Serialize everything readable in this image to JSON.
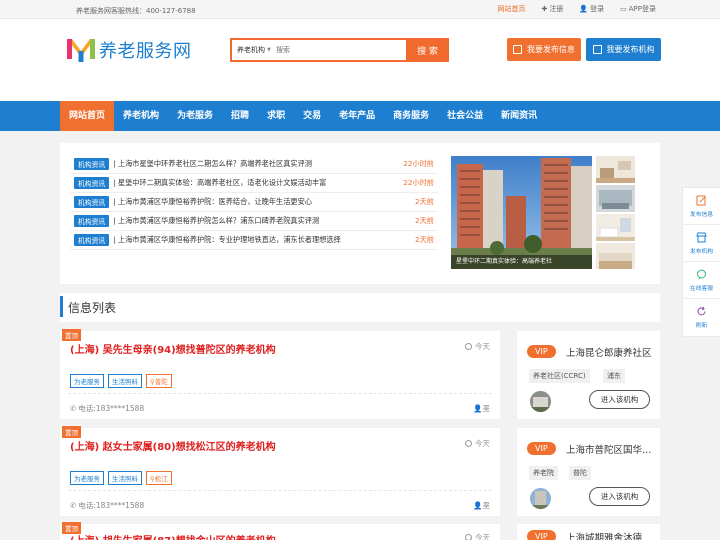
{
  "topbar": {
    "hotline": "养老服务网客服热线：400-127-6788",
    "links": [
      {
        "label": "网站首页",
        "active": true,
        "icon": ""
      },
      {
        "label": "注册",
        "active": false,
        "icon": "plus-icon"
      },
      {
        "label": "登录",
        "active": false,
        "icon": "user-icon"
      },
      {
        "label": "APP登录",
        "active": false,
        "icon": "laptop-icon"
      }
    ]
  },
  "header": {
    "logo_text": "养老服务网",
    "search": {
      "category": "养老机构",
      "placeholder": "搜索",
      "button": "搜 索"
    },
    "publish_info": "我要发布信息",
    "publish_org": "我要发布机构"
  },
  "nav": {
    "items": [
      "网站首页",
      "养老机构",
      "为老服务",
      "招聘",
      "求职",
      "交易",
      "老年产品",
      "商务服务",
      "社会公益",
      "新闻资讯"
    ]
  },
  "news": {
    "items": [
      {
        "tag": "机构资讯",
        "title": "| 上海市星堡中环养老社区二期怎么样？高端养老社区真实评测",
        "time": "22小时前"
      },
      {
        "tag": "机构资讯",
        "title": "| 星堡中环二期真实体验：高端养老社区，适老化设计文娱活动丰富",
        "time": "22小时前"
      },
      {
        "tag": "机构资讯",
        "title": "| 上海市黄浦区华康恒裕养护院：医养结合，让晚年生活更安心",
        "time": "2天前"
      },
      {
        "tag": "机构资讯",
        "title": "| 上海市黄浦区华康恒裕养护院怎么样？浦东口碑养老院真实评测",
        "time": "2天前"
      },
      {
        "tag": "机构资讯",
        "title": "| 上海市黄浦区华康恒裕养护院：专业护理地铁直达，浦东长者理想选择",
        "time": "2天前"
      }
    ],
    "photo_caption": "星堡中环二期真实体验：高端养老社"
  },
  "section": {
    "title": "信息列表"
  },
  "listings": [
    {
      "flag": "置顶",
      "title": "(上海) 吴先生母亲(94)想找普陀区的养老机构",
      "time": "今天",
      "tags": [
        "为老服务",
        "生活照料"
      ],
      "location": "普陀",
      "phone": "电话:183****1588",
      "person": "垩"
    },
    {
      "flag": "置顶",
      "title": "(上海) 赵女士家属(80)想找松江区的养老机构",
      "time": "今天",
      "tags": [
        "为老服务",
        "生活照料"
      ],
      "location": "松江",
      "phone": "电话:183****1588",
      "person": "垩"
    },
    {
      "flag": "置顶",
      "title": "(上海) 胡先生家属(87)想找金山区的养老机构",
      "time": "今天",
      "tags": [],
      "location": "",
      "phone": "",
      "person": ""
    }
  ],
  "vip_orgs": [
    {
      "badge": "VIP",
      "name": "上海昆仑郎康养社区",
      "tags": [
        "养老社区(CCRC)",
        "浦东"
      ],
      "button": "进入该机构"
    },
    {
      "badge": "VIP",
      "name": "上海市普陀区国华…",
      "tags": [
        "养老院",
        "普陀"
      ],
      "button": "进入该机构"
    },
    {
      "badge": "VIP",
      "name": "上海城期雅舍沐德",
      "tags": [],
      "button": ""
    }
  ],
  "sidefloat": {
    "items": [
      {
        "label": "发布信息",
        "icon": "edit-icon",
        "color": "#1e7fd0"
      },
      {
        "label": "发布机构",
        "icon": "shop-icon",
        "color": "#1e7fd0"
      },
      {
        "label": "在线客服",
        "icon": "chat-icon",
        "color": "#1e7fd0"
      },
      {
        "label": "刷新",
        "icon": "refresh-icon",
        "color": "#1e7fd0"
      }
    ]
  },
  "colors": {
    "brand_blue": "#1e7fd0",
    "brand_orange": "#f0702f",
    "title_red": "#e02020"
  }
}
